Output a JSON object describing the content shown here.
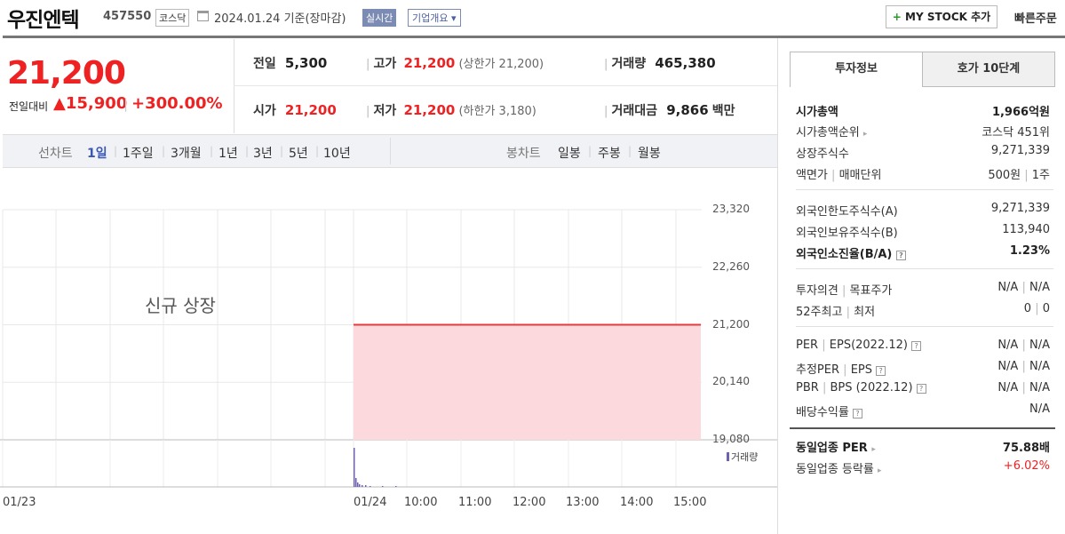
{
  "header": {
    "name": "우진엔텍",
    "code": "457550",
    "market": "코스닥",
    "date": "2024.01.24 기준(장마감)",
    "realtime": "실시간",
    "company_overview": "기업개요 ▾",
    "my_stock": "MY STOCK 추가",
    "my_stock_plus": "+",
    "quick_order": "빠른주문"
  },
  "price": {
    "current": "21,200",
    "prev_label": "전일대비",
    "change": "▲15,900",
    "change_pct": "+300.00%"
  },
  "quote": {
    "prev_close_label": "전일",
    "prev_close": "5,300",
    "high_label": "고가",
    "high": "21,200",
    "upper_limit": "(상한가 21,200)",
    "volume_label": "거래량",
    "volume": "465,380",
    "open_label": "시가",
    "open": "21,200",
    "low_label": "저가",
    "low": "21,200",
    "lower_limit": "(하한가 3,180)",
    "amount_label": "거래대금",
    "amount": "9,866",
    "amount_unit": "백만"
  },
  "range_bar": {
    "line_label": "선차트",
    "ranges": [
      "1일",
      "1주일",
      "3개월",
      "1년",
      "3년",
      "5년",
      "10년"
    ],
    "active": "1일",
    "candle_label": "봉차트",
    "candles": [
      "일봉",
      "주봉",
      "월봉"
    ]
  },
  "chart_data": {
    "type": "area",
    "annotation": "신규 상장",
    "y_ticks": [
      "23,320",
      "22,260",
      "21,200",
      "20,140",
      "19,080"
    ],
    "ylim": [
      19080,
      23320
    ],
    "x_ticks": [
      "01/23",
      "01/24",
      "10:00",
      "11:00",
      "12:00",
      "13:00",
      "14:00",
      "15:00"
    ],
    "price_series": {
      "start": "01/24 09:00",
      "end": "01/24 15:30",
      "value": 21200
    },
    "volume_label": "거래량",
    "colors": {
      "line": "#e53b3b",
      "fill": "#fbd9dc",
      "volume": "#7060b0"
    }
  },
  "tabs": {
    "invest": "투자정보",
    "orderbook": "호가 10단계"
  },
  "invest": {
    "market_cap_label": "시가총액",
    "market_cap": "1,966억원",
    "rank_label": "시가총액순위",
    "rank": "코스닥 451위",
    "shares_label": "상장주식수",
    "shares": "9,271,339",
    "par_label": "액면가",
    "par_sep": "|",
    "trade_unit_label": "매매단위",
    "par": "500원",
    "trade_unit": "1주",
    "foreign_limit_label": "외국인한도주식수(A)",
    "foreign_limit": "9,271,339",
    "foreign_hold_label": "외국인보유주식수(B)",
    "foreign_hold": "113,940",
    "foreign_rate_label": "외국인소진율(B/A)",
    "foreign_rate": "1.23%",
    "opinion_label": "투자의견",
    "target_label": "목표주가",
    "opinion": "N/A",
    "target": "N/A",
    "w52_high_label": "52주최고",
    "w52_low_label": "최저",
    "w52_high": "0",
    "w52_low": "0",
    "per_label": "PER",
    "eps_label": "EPS(2022.12)",
    "per": "N/A",
    "eps": "N/A",
    "est_per_label": "추정PER",
    "est_eps_label": "EPS",
    "est_per": "N/A",
    "est_eps": "N/A",
    "pbr_label": "PBR",
    "bps_label": "BPS (2022.12)",
    "pbr": "N/A",
    "bps": "N/A",
    "dividend_label": "배당수익률",
    "dividend": "N/A",
    "sector_per_label": "동일업종 PER",
    "sector_per": "75.88배",
    "sector_rate_label": "동일업종 등락률",
    "sector_rate": "+6.02%"
  }
}
